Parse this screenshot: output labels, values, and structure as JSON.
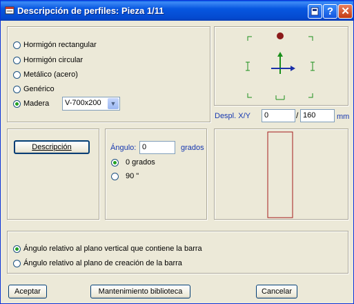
{
  "window": {
    "title": "Descripción de perfiles: Pieza 1/11"
  },
  "profile_types": [
    {
      "label": "Hormigón rectangular",
      "selected": false
    },
    {
      "label": "Hormigón circular",
      "selected": false
    },
    {
      "label": "Metálico (acero)",
      "selected": false
    },
    {
      "label": "Genérico",
      "selected": false
    },
    {
      "label": "Madera",
      "selected": true
    }
  ],
  "madera_select": {
    "value": "V-700x200"
  },
  "displacement": {
    "label": "Despl. X/Y",
    "x": "0",
    "separator": "/",
    "y": "160",
    "unit": "mm"
  },
  "descripcion_button": "Descripción",
  "angle": {
    "label": "Ángulo:",
    "value": "0",
    "unit": "grados",
    "options": [
      {
        "label": "0 grados",
        "selected": true
      },
      {
        "label": "90 \"",
        "selected": false
      }
    ]
  },
  "relative": [
    {
      "label": "Ángulo relativo al plano vertical que contiene la barra",
      "selected": true
    },
    {
      "label": "Ángulo relativo al plano de creación de la barra",
      "selected": false
    }
  ],
  "buttons": {
    "accept": "Aceptar",
    "library": "Mantenimiento biblioteca",
    "cancel": "Cancelar"
  },
  "colors": {
    "titlebar": "#0757e0",
    "axis_y": "#1a8f1a",
    "axis_x": "#1a2fa8",
    "marker": "#8b1a1a",
    "section_outline": "#a51c1c"
  }
}
